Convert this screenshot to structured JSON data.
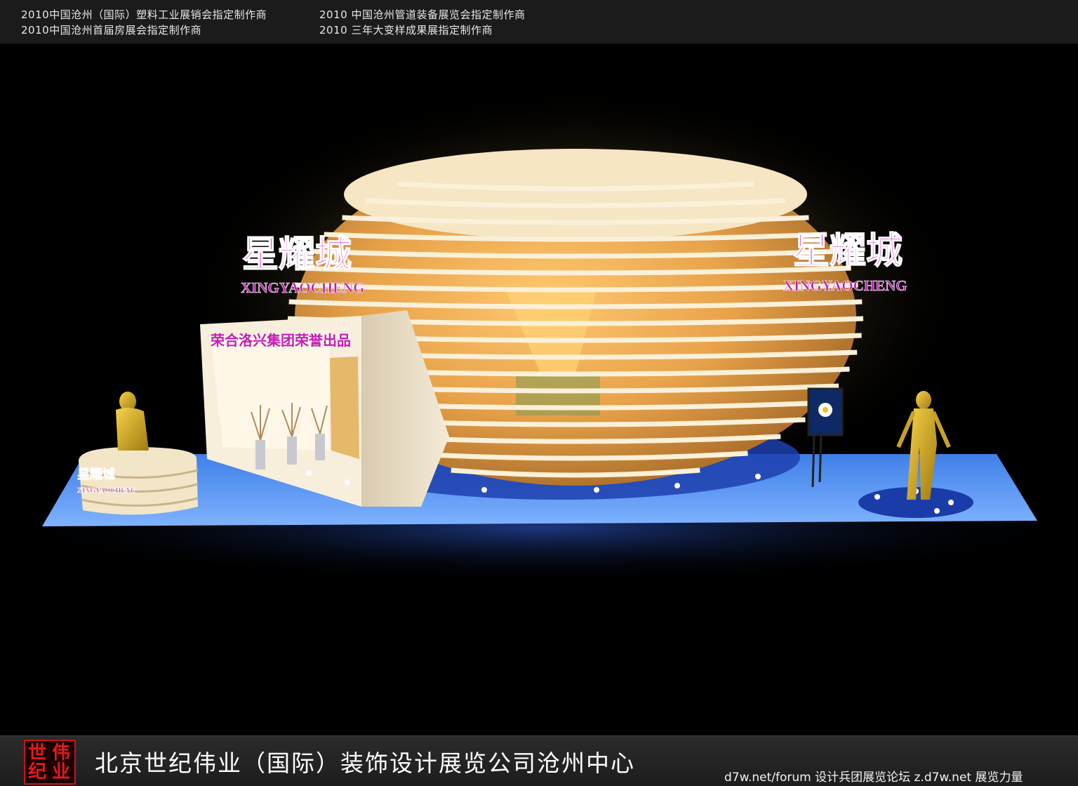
{
  "banner": {
    "line1_left": "2010中国沧州（国际）塑料工业展销会指定制作商",
    "line1_right": "2010 中国沧州管道装备展览会指定制作商",
    "line2_left": "2010中国沧州首届房展会指定制作商",
    "line2_right": "2010 三年大变样成果展指定制作商"
  },
  "booth": {
    "sign_cn": "星耀城",
    "sign_en": "XINGYAOCHENG",
    "door_text": "荣合洛兴集团荣誉出品",
    "reception_cn": "星耀城",
    "reception_en": "XINGYAOCHENG"
  },
  "footer": {
    "logo_chars": [
      "世",
      "伟",
      "纪",
      "业"
    ],
    "company": "北京世纪伟业（国际）装饰设计展览公司沧州中心",
    "site_credit": "d7w.net/forum 设计兵团展览论坛   z.d7w.net 展览力量"
  },
  "colors": {
    "floor": "#4f8ff0",
    "dome": "#f3dca8",
    "sign": "#d21fc4",
    "logo_red": "#c71515"
  }
}
